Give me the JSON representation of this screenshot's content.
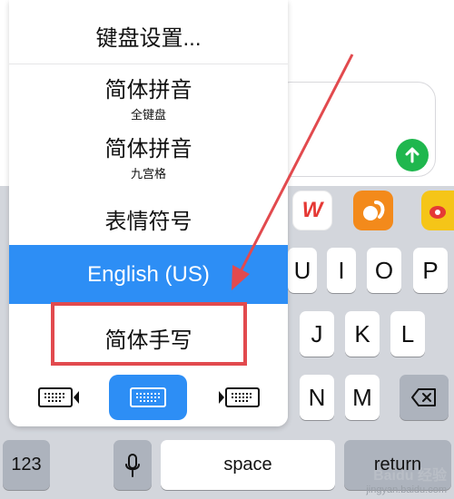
{
  "menu": {
    "items": [
      {
        "title": "键盘设置...",
        "subtitle": ""
      },
      {
        "title": "简体拼音",
        "subtitle": "全键盘"
      },
      {
        "title": "简体拼音",
        "subtitle": "九宫格"
      },
      {
        "title": "表情符号",
        "subtitle": ""
      },
      {
        "title": "English (US)",
        "subtitle": ""
      },
      {
        "title": "简体手写",
        "subtitle": ""
      }
    ],
    "selected_index": 4
  },
  "keys": {
    "row1": [
      "U",
      "I",
      "O",
      "P"
    ],
    "row2": [
      "J",
      "K",
      "L"
    ],
    "row3": [
      "N",
      "M"
    ],
    "numbers": "123",
    "space": "space",
    "return": "return"
  },
  "apps": {
    "wps": "W",
    "weibo": ""
  },
  "watermark": {
    "line1": "Baidu 经验",
    "line2": "jingyan.baidu.com"
  },
  "colors": {
    "accent_blue": "#2d8ef5",
    "highlight_red": "#e24a4e",
    "send_green": "#1fb74e"
  },
  "icons": {
    "send": "arrow-up-icon",
    "mic": "microphone-icon",
    "delete": "backspace-icon",
    "keyboard_left": "keyboard-left-icon",
    "keyboard_center": "keyboard-icon",
    "keyboard_right": "keyboard-right-icon"
  }
}
